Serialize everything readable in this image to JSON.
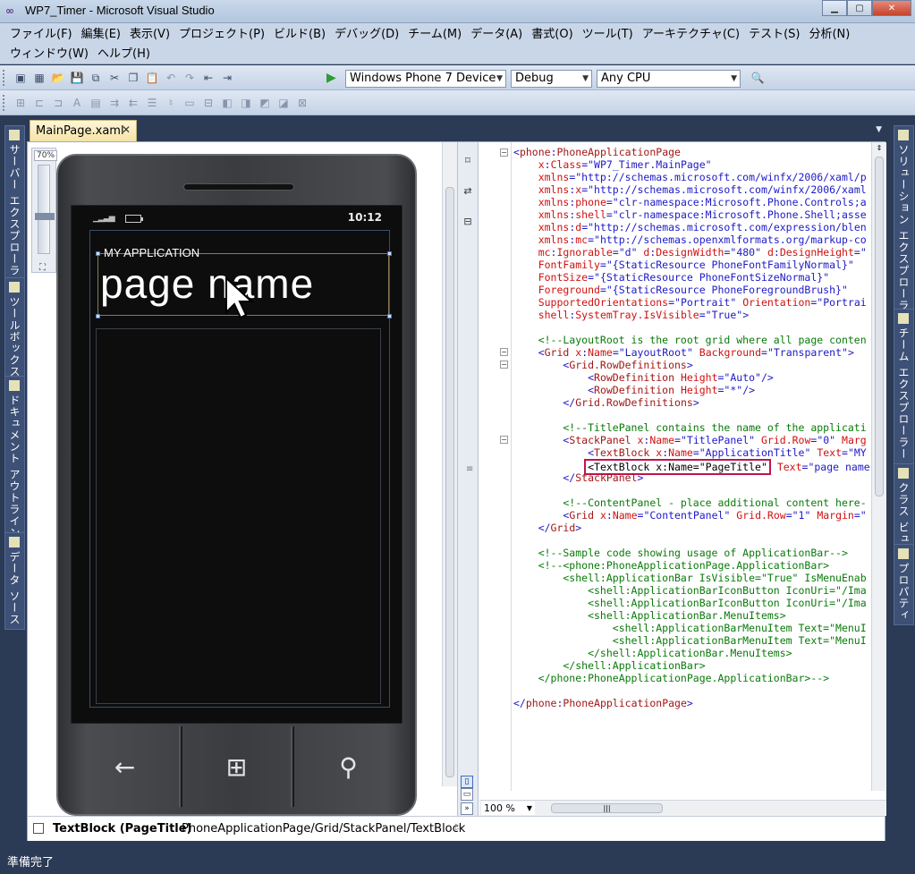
{
  "window": {
    "title": "WP7_Timer - Microsoft Visual Studio"
  },
  "menu": {
    "row1": [
      "ファイル(F)",
      "編集(E)",
      "表示(V)",
      "プロジェクト(P)",
      "ビルド(B)",
      "デバッグ(D)",
      "チーム(M)",
      "データ(A)",
      "書式(O)",
      "ツール(T)",
      "アーキテクチャ(C)",
      "テスト(S)",
      "分析(N)"
    ],
    "row2": [
      "ウィンドウ(W)",
      "ヘルプ(H)"
    ]
  },
  "toolbar": {
    "device": "Windows Phone 7 Device",
    "config": "Debug",
    "platform": "Any CPU"
  },
  "left_panels": [
    "サーバー エクスプローラー",
    "ツールボックス",
    "ドキュメント アウトライン",
    "データ ソース"
  ],
  "right_panels": [
    "ソリューション エクスプローラー",
    "チーム エクスプローラー",
    "クラス ビュー",
    "プロパティ"
  ],
  "doc_tab": {
    "label": "MainPage.xaml"
  },
  "designer": {
    "zoom_label": "70%",
    "clock": "10:12",
    "app_title": "MY APPLICATION",
    "page_title": "page name"
  },
  "xaml_lines": [
    [
      [
        "cb",
        "<"
      ],
      [
        "cm",
        "phone"
      ],
      [
        "cb",
        ":"
      ],
      [
        "cm",
        "PhoneApplicationPage"
      ]
    ],
    [
      [
        "ca",
        "    x"
      ],
      [
        "cb",
        ":"
      ],
      [
        "ca",
        "Class"
      ],
      [
        "cb",
        "=\"WP7_Timer.MainPage\""
      ]
    ],
    [
      [
        "ca",
        "    xmlns"
      ],
      [
        "cb",
        "=\"http://schemas.microsoft.com/winfx/2006/xaml/p"
      ]
    ],
    [
      [
        "ca",
        "    xmlns"
      ],
      [
        "cb",
        ":"
      ],
      [
        "ca",
        "x"
      ],
      [
        "cb",
        "=\"http://schemas.microsoft.com/winfx/2006/xaml"
      ]
    ],
    [
      [
        "ca",
        "    xmlns"
      ],
      [
        "cb",
        ":"
      ],
      [
        "ca",
        "phone"
      ],
      [
        "cb",
        "=\"clr-namespace:Microsoft.Phone.Controls;a"
      ]
    ],
    [
      [
        "ca",
        "    xmlns"
      ],
      [
        "cb",
        ":"
      ],
      [
        "ca",
        "shell"
      ],
      [
        "cb",
        "=\"clr-namespace:Microsoft.Phone.Shell;asse"
      ]
    ],
    [
      [
        "ca",
        "    xmlns"
      ],
      [
        "cb",
        ":"
      ],
      [
        "ca",
        "d"
      ],
      [
        "cb",
        "=\"http://schemas.microsoft.com/expression/blen"
      ]
    ],
    [
      [
        "ca",
        "    xmlns"
      ],
      [
        "cb",
        ":"
      ],
      [
        "ca",
        "mc"
      ],
      [
        "cb",
        "=\"http://schemas.openxmlformats.org/markup-co"
      ]
    ],
    [
      [
        "ca",
        "    mc"
      ],
      [
        "cb",
        ":"
      ],
      [
        "ca",
        "Ignorable"
      ],
      [
        "cb",
        "=\"d\" "
      ],
      [
        "ca",
        "d"
      ],
      [
        "cb",
        ":"
      ],
      [
        "ca",
        "DesignWidth"
      ],
      [
        "cb",
        "=\"480\" "
      ],
      [
        "ca",
        "d"
      ],
      [
        "cb",
        ":"
      ],
      [
        "ca",
        "DesignHeight"
      ],
      [
        "cb",
        "=\""
      ]
    ],
    [
      [
        "ca",
        "    FontFamily"
      ],
      [
        "cb",
        "=\"{StaticResource PhoneFontFamilyNormal}\""
      ]
    ],
    [
      [
        "ca",
        "    FontSize"
      ],
      [
        "cb",
        "=\"{StaticResource PhoneFontSizeNormal}\""
      ]
    ],
    [
      [
        "ca",
        "    Foreground"
      ],
      [
        "cb",
        "=\"{StaticResource PhoneForegroundBrush}\""
      ]
    ],
    [
      [
        "ca",
        "    SupportedOrientations"
      ],
      [
        "cb",
        "=\"Portrait\" "
      ],
      [
        "ca",
        "Orientation"
      ],
      [
        "cb",
        "=\"Portrai"
      ]
    ],
    [
      [
        "ca",
        "    shell"
      ],
      [
        "cb",
        ":"
      ],
      [
        "ca",
        "SystemTray.IsVisible"
      ],
      [
        "cb",
        "=\"True\">"
      ]
    ],
    [
      [
        "cb",
        ""
      ]
    ],
    [
      [
        "cg",
        "    <!--LayoutRoot is the root grid where all page conten"
      ]
    ],
    [
      [
        "cb",
        "    <"
      ],
      [
        "cm",
        "Grid"
      ],
      [
        "ca",
        " x"
      ],
      [
        "cb",
        ":"
      ],
      [
        "ca",
        "Name"
      ],
      [
        "cb",
        "=\"LayoutRoot\" "
      ],
      [
        "ca",
        "Background"
      ],
      [
        "cb",
        "=\"Transparent\">"
      ]
    ],
    [
      [
        "cb",
        "        <"
      ],
      [
        "cm",
        "Grid.RowDefinitions"
      ],
      [
        "cb",
        ">"
      ]
    ],
    [
      [
        "cb",
        "            <"
      ],
      [
        "cm",
        "RowDefinition"
      ],
      [
        "ca",
        " Height"
      ],
      [
        "cb",
        "=\"Auto\"/>"
      ]
    ],
    [
      [
        "cb",
        "            <"
      ],
      [
        "cm",
        "RowDefinition"
      ],
      [
        "ca",
        " Height"
      ],
      [
        "cb",
        "=\"*\"/>"
      ]
    ],
    [
      [
        "cb",
        "        </"
      ],
      [
        "cm",
        "Grid.RowDefinitions"
      ],
      [
        "cb",
        ">"
      ]
    ],
    [
      [
        "cb",
        ""
      ]
    ],
    [
      [
        "cg",
        "        <!--TitlePanel contains the name of the applicati"
      ]
    ],
    [
      [
        "cb",
        "        <"
      ],
      [
        "cm",
        "StackPanel"
      ],
      [
        "ca",
        " x"
      ],
      [
        "cb",
        ":"
      ],
      [
        "ca",
        "Name"
      ],
      [
        "cb",
        "=\"TitlePanel\" "
      ],
      [
        "ca",
        "Grid.Row"
      ],
      [
        "cb",
        "=\"0\" "
      ],
      [
        "ca",
        "Marg"
      ]
    ],
    [
      [
        "cb",
        "            <"
      ],
      [
        "cm",
        "TextBlock"
      ],
      [
        "ca",
        " x"
      ],
      [
        "cb",
        ":"
      ],
      [
        "ca",
        "Name"
      ],
      [
        "cb",
        "=\"ApplicationTitle\" "
      ],
      [
        "ca",
        "Text"
      ],
      [
        "cb",
        "=\"MY"
      ]
    ],
    [
      [
        "hl",
        "<TextBlock x:Name=\"PageTitle\""
      ],
      [
        "ca",
        " Text"
      ],
      [
        "cb",
        "=\"page name"
      ]
    ],
    [
      [
        "cb",
        "        </"
      ],
      [
        "cm",
        "StackPanel"
      ],
      [
        "cb",
        ">"
      ]
    ],
    [
      [
        "cb",
        ""
      ]
    ],
    [
      [
        "cg",
        "        <!--ContentPanel - place additional content here-"
      ]
    ],
    [
      [
        "cb",
        "        <"
      ],
      [
        "cm",
        "Grid"
      ],
      [
        "ca",
        " x"
      ],
      [
        "cb",
        ":"
      ],
      [
        "ca",
        "Name"
      ],
      [
        "cb",
        "=\"ContentPanel\" "
      ],
      [
        "ca",
        "Grid.Row"
      ],
      [
        "cb",
        "=\"1\" "
      ],
      [
        "ca",
        "Margin"
      ],
      [
        "cb",
        "=\""
      ]
    ],
    [
      [
        "cb",
        "    </"
      ],
      [
        "cm",
        "Grid"
      ],
      [
        "cb",
        ">"
      ]
    ],
    [
      [
        "cb",
        ""
      ]
    ],
    [
      [
        "cg",
        "    <!--Sample code showing usage of ApplicationBar-->"
      ]
    ],
    [
      [
        "cg",
        "    <!--<phone:PhoneApplicationPage.ApplicationBar>"
      ]
    ],
    [
      [
        "cg",
        "        <shell:ApplicationBar IsVisible=\"True\" IsMenuEnab"
      ]
    ],
    [
      [
        "cg",
        "            <shell:ApplicationBarIconButton IconUri=\"/Ima"
      ]
    ],
    [
      [
        "cg",
        "            <shell:ApplicationBarIconButton IconUri=\"/Ima"
      ]
    ],
    [
      [
        "cg",
        "            <shell:ApplicationBar.MenuItems>"
      ]
    ],
    [
      [
        "cg",
        "                <shell:ApplicationBarMenuItem Text=\"MenuI"
      ]
    ],
    [
      [
        "cg",
        "                <shell:ApplicationBarMenuItem Text=\"MenuI"
      ]
    ],
    [
      [
        "cg",
        "            </shell:ApplicationBar.MenuItems>"
      ]
    ],
    [
      [
        "cg",
        "        </shell:ApplicationBar>"
      ]
    ],
    [
      [
        "cg",
        "    </phone:PhoneApplicationPage.ApplicationBar>-->"
      ]
    ],
    [
      [
        "cb",
        ""
      ]
    ],
    [
      [
        "cb",
        "</"
      ],
      [
        "cm",
        "phone"
      ],
      [
        "cb",
        ":"
      ],
      [
        "cm",
        "PhoneApplicationPage"
      ],
      [
        "cb",
        ">"
      ]
    ]
  ],
  "xaml_zoom": "100 %",
  "breadcrumb": {
    "element": "TextBlock (PageTitle)",
    "path": "PhoneApplicationPage/Grid/StackPanel/TextBlock"
  },
  "status": {
    "text": "準備完了"
  }
}
